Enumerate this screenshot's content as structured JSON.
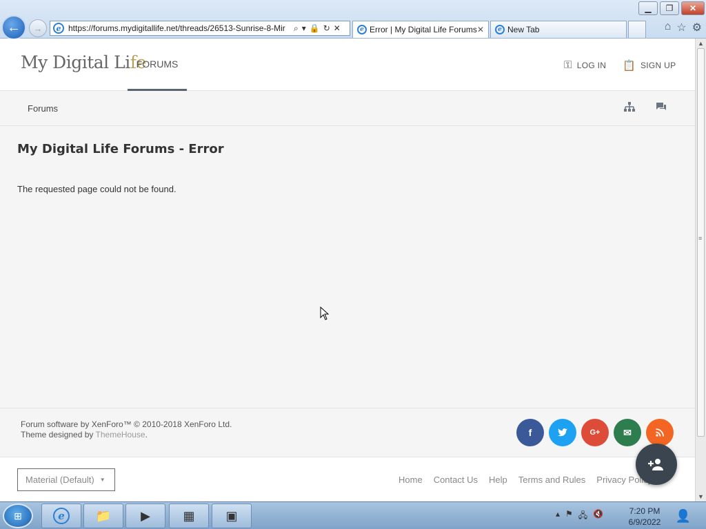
{
  "browser": {
    "url": "https://forums.mydigitallife.net/threads/26513-Sunrise-8-Mir",
    "tabs": [
      {
        "title": "Error | My Digital Life Forums",
        "active": true
      },
      {
        "title": "New Tab",
        "active": false
      }
    ],
    "window_buttons": {
      "minimize": "▁",
      "restore": "❐",
      "close": "✕"
    },
    "icons": [
      "back-icon",
      "forward-icon",
      "search-icon",
      "lock-icon",
      "refresh-icon",
      "stop-icon",
      "home-icon",
      "favorites-icon",
      "tools-icon"
    ]
  },
  "header": {
    "logo": {
      "main": "My Digital Li",
      "accent": "fe"
    },
    "nav_forums": "FORUMS",
    "login": "LOG IN",
    "signup": "SIGN UP"
  },
  "subnav": {
    "breadcrumb": "Forums"
  },
  "main": {
    "title": "My Digital Life Forums - Error",
    "message": "The requested page could not be found."
  },
  "footer": {
    "credit_line1": "Forum software by XenForo™ © 2010-2018 XenForo Ltd.",
    "credit_line2_prefix": "Theme designed by ",
    "credit_line2_link": "ThemeHouse",
    "credit_line2_suffix": ".",
    "social": [
      {
        "name": "facebook",
        "glyph": "f",
        "color": "#3b5998"
      },
      {
        "name": "twitter",
        "glyph": "t",
        "color": "#1da1f2"
      },
      {
        "name": "google-plus",
        "glyph": "G+",
        "color": "#dd4b39"
      },
      {
        "name": "email",
        "glyph": "✉",
        "color": "#2e7d4f"
      },
      {
        "name": "rss",
        "glyph": "◉",
        "color": "#f26522"
      }
    ],
    "style_chooser": "Material (Default)",
    "links": [
      "Home",
      "Contact Us",
      "Help",
      "Terms and Rules",
      "Privacy Policy"
    ]
  },
  "taskbar": {
    "apps": [
      "internet-explorer",
      "windows-explorer",
      "media-player",
      "app-4",
      "app-5"
    ],
    "time": "7:20 PM",
    "date": "6/9/2022"
  }
}
